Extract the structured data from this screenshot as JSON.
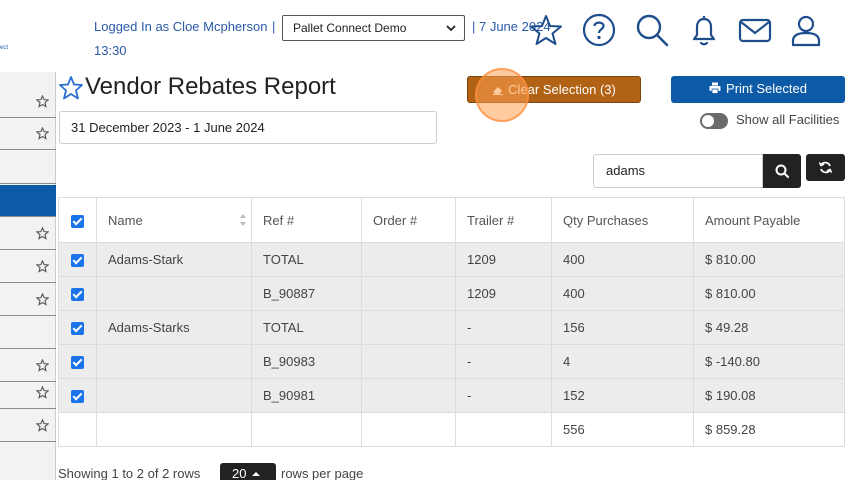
{
  "header": {
    "brand_sub": "ect",
    "login_text": "Logged In as Cloe Mcpherson",
    "separator": "|",
    "time": "13:30",
    "company_select": "Pallet Connect Demo",
    "date_text": "| 7 June 2024",
    "icons": [
      "star-icon",
      "help-icon",
      "search-icon",
      "bell-icon",
      "mail-icon",
      "user-icon"
    ]
  },
  "sidebar": {
    "rows": [
      {
        "star": true,
        "active": false
      },
      {
        "star": true,
        "active": false
      },
      {
        "star": false,
        "active": false
      },
      {
        "star": false,
        "active": true
      },
      {
        "star": true,
        "active": false
      },
      {
        "star": true,
        "active": false
      },
      {
        "star": true,
        "active": false
      },
      {
        "star": false,
        "active": false
      },
      {
        "star": true,
        "active": false
      },
      {
        "star": true,
        "active": false
      },
      {
        "star": true,
        "active": false
      }
    ]
  },
  "page": {
    "title": "Vendor Rebates Report",
    "date_range": "31 December 2023 - 1 June 2024",
    "clear_button": "Clear Selection (3)",
    "print_button": "Print Selected",
    "toggle_label": "Show all Facilities",
    "search_value": "adams"
  },
  "table": {
    "headers": [
      "Name",
      "Ref #",
      "Order #",
      "Trailer #",
      "Qty Purchases",
      "Amount Payable"
    ],
    "rows": [
      {
        "checked": true,
        "name": "Adams-Stark",
        "ref": "TOTAL",
        "order": "",
        "trailer": "1209",
        "qty": "400",
        "amount": "$ 810.00"
      },
      {
        "checked": true,
        "name": "",
        "ref": "B_90887",
        "order": "",
        "trailer": "1209",
        "qty": "400",
        "amount": "$ 810.00"
      },
      {
        "checked": true,
        "name": "Adams-Starks",
        "ref": "TOTAL",
        "order": "",
        "trailer": "-",
        "qty": "156",
        "amount": "$ 49.28"
      },
      {
        "checked": true,
        "name": "",
        "ref": "B_90983",
        "order": "",
        "trailer": "-",
        "qty": "4",
        "amount": "$ -140.80"
      },
      {
        "checked": true,
        "name": "",
        "ref": "B_90981",
        "order": "",
        "trailer": "-",
        "qty": "152",
        "amount": "$ 190.08"
      }
    ],
    "totals": {
      "qty": "556",
      "amount": "$ 859.28"
    }
  },
  "footer": {
    "showing": "Showing 1 to 2 of 2 rows",
    "rows_per_page_value": "20",
    "rows_per_page_label": "rows per page"
  },
  "colors": {
    "primary": "#0d5aa7",
    "clear_button": "#b26215",
    "link_text": "#2a5aa8",
    "checkbox": "#1a73e8"
  }
}
